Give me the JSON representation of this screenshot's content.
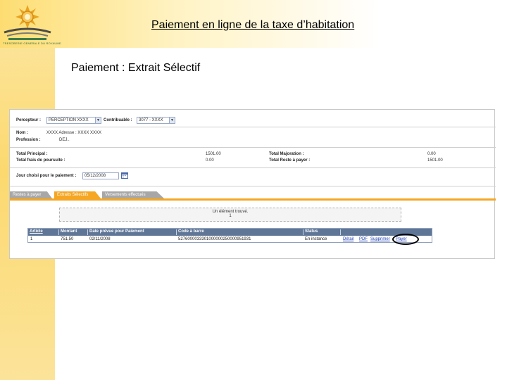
{
  "slide": {
    "title": "Paiement en ligne de la taxe d’habitation",
    "subtitle": "Paiement : Extrait Sélectif",
    "logo_caption": "TRESORERIE GENERALE DU ROYAUME"
  },
  "form": {
    "percepteur_label": "Percepteur :",
    "percepteur_value": "PERCEPTION XXXX",
    "contribuable_label": "Contribuable :",
    "contribuable_value": "3077 - XXXX",
    "nom_label": "Nom :",
    "nom_value": "XXXX Adresse : XXXX XXXX",
    "profession_label": "Profession :",
    "profession_value": "DEJ..",
    "total_principal_label": "Total Principal :",
    "total_principal_value": "1501.00",
    "total_frais_label": "Total frais de poursuite :",
    "total_frais_value": "0.00",
    "total_majoration_label": "Total Majoration :",
    "total_majoration_value": "0.00",
    "total_reste_label": "Total Reste à payer :",
    "total_reste_value": "1501.00",
    "date_label": "Jour choisi pour le paiement :",
    "date_value": "05/12/2008"
  },
  "tabs": [
    {
      "label": "Restes à payer"
    },
    {
      "label": "Extraits Sélectifs"
    },
    {
      "label": "Versements effectués"
    }
  ],
  "message": {
    "line1": "Un élément trouvé.",
    "line2": "1"
  },
  "results": {
    "headers": [
      "Article",
      "Montant",
      "Date prévue pour Paiement",
      "Code à barre",
      "Status"
    ],
    "row": {
      "article": "1",
      "montant": "751.50",
      "date": "02/11/2008",
      "code": "5276000033301000000250000951931",
      "status": "En instance"
    },
    "links": [
      "Détail",
      "PDF",
      "Supprimer",
      "Payer"
    ]
  },
  "colors": {
    "accent": "#f5a623",
    "table_header": "#5f7696",
    "link": "#1f3fb3"
  }
}
